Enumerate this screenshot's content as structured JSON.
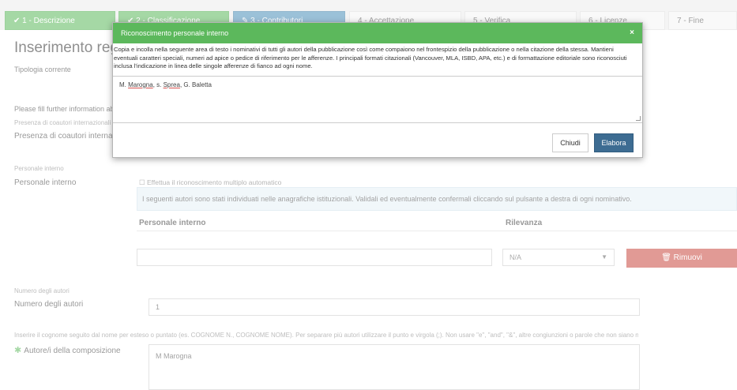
{
  "steps": [
    {
      "label": "1 - Descrizione",
      "icon": "check-icon",
      "state": "done"
    },
    {
      "label": "2 - Classificazione",
      "icon": "check-icon",
      "state": "done"
    },
    {
      "label": "3 - Contributori",
      "icon": "edit-icon",
      "state": "active"
    },
    {
      "label": "4 - Accettazione",
      "state": "pending"
    },
    {
      "label": "5 - Verifica",
      "state": "pending"
    },
    {
      "label": "6 - Licenze",
      "state": "pending"
    },
    {
      "label": "7 - Fine",
      "state": "pending"
    }
  ],
  "page": {
    "title": "Inserimento regis",
    "type_label": "Tipologia corrente",
    "further_info": "Please fill further information abou",
    "intl_small": "Presenza di coautori internazionali",
    "intl_label": "Presenza di coautori internazional",
    "internal_small": "Personale interno",
    "internal_label": "Personale interno",
    "auto_checkbox": "Effettua il riconoscimento multiplo automatico",
    "info_text": "I seguenti autori sono stati individuati nelle anagrafiche istituzionali. Validali ed eventualmente confermali cliccando sul pulsante a destra di ogni nominativo.",
    "col_internal": "Personale interno",
    "col_relevance": "Rilevanza",
    "relevance_value": "N/A",
    "remove_label": "Rimuovi",
    "num_small": "Numero degli autori",
    "num_label": "Numero degli autori",
    "num_value": "1",
    "authors_hint": "Inserire il cognome seguito dal nome per esteso o puntato (es. COGNOME N., COGNOME NOME). Per separare più autori utilizzare il punto e virgola (;). Non usare \"e\", \"and\", \"&\", altre congiunzioni o parole che non siano nominativi.",
    "authors_label": "Autore/i della composizione",
    "authors_value": "M Marogna"
  },
  "modal": {
    "title": "Riconoscimento personale interno",
    "close": "×",
    "description": "Copia e incolla nella seguente area di testo i nominativi di tutti gli autori della pubblicazione così come compaiono nel frontespizio della pubblicazione o nella citazione della stessa. Mantieni eventuali caratteri speciali, numeri ad apice o pedice di riferimento per le afferenze. I principali formati citazionali (Vancouver, MLA, ISBD, APA, etc.) e di formattazione editoriale sono riconosciuti inclusa l'indicazione in linea delle singole afferenze di fianco ad ogni nome.",
    "authors_text": {
      "a": "M. ",
      "b": "Marogna",
      "c": ", s. ",
      "d": "Sprea",
      "e": ", G. Baletta"
    },
    "btn_close": "Chiudi",
    "btn_process": "Elabora"
  }
}
